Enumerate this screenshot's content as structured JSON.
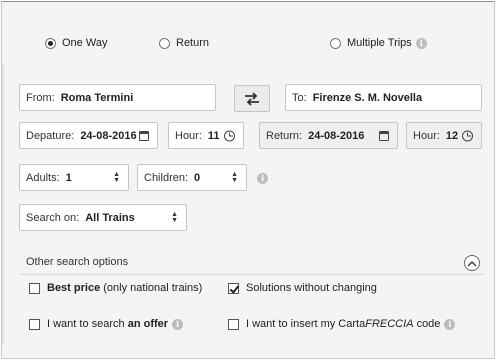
{
  "trip_type": {
    "one_way": "One Way",
    "return": "Return",
    "multiple_trips": "Multiple Trips",
    "selected": "one_way"
  },
  "route": {
    "from_label": "From:",
    "from_value": "Roma Termini",
    "to_label": "To:",
    "to_value": "Firenze S. M. Novella"
  },
  "departure": {
    "date_label": "Depature:",
    "date_value": "24-08-2016",
    "hour_label": "Hour:",
    "hour_value": "11"
  },
  "return": {
    "date_label": "Return:",
    "date_value": "24-08-2016",
    "hour_label": "Hour:",
    "hour_value": "12"
  },
  "passengers": {
    "adults_label": "Adults:",
    "adults_value": "1",
    "children_label": "Children:",
    "children_value": "0"
  },
  "search_on": {
    "label": "Search on:",
    "value": "All Trains"
  },
  "other_options": {
    "title": "Other search options",
    "best_price_bold": "Best price",
    "best_price_rest": "(only national trains)",
    "best_price_checked": false,
    "solutions_without_changing": "Solutions without changing",
    "solutions_checked": true,
    "offer_prefix": "I want to search",
    "offer_bold": "an offer",
    "offer_checked": false,
    "carta_prefix": "I want to insert my Carta",
    "carta_italic": "FRECCIA",
    "carta_suffix": "code",
    "carta_checked": false
  },
  "icons": {
    "info": "info-icon",
    "swap": "swap-arrows-icon",
    "calendar": "calendar-icon",
    "clock": "clock-icon",
    "stepper": "up-down-icon",
    "collapse": "chevron-up-icon"
  }
}
